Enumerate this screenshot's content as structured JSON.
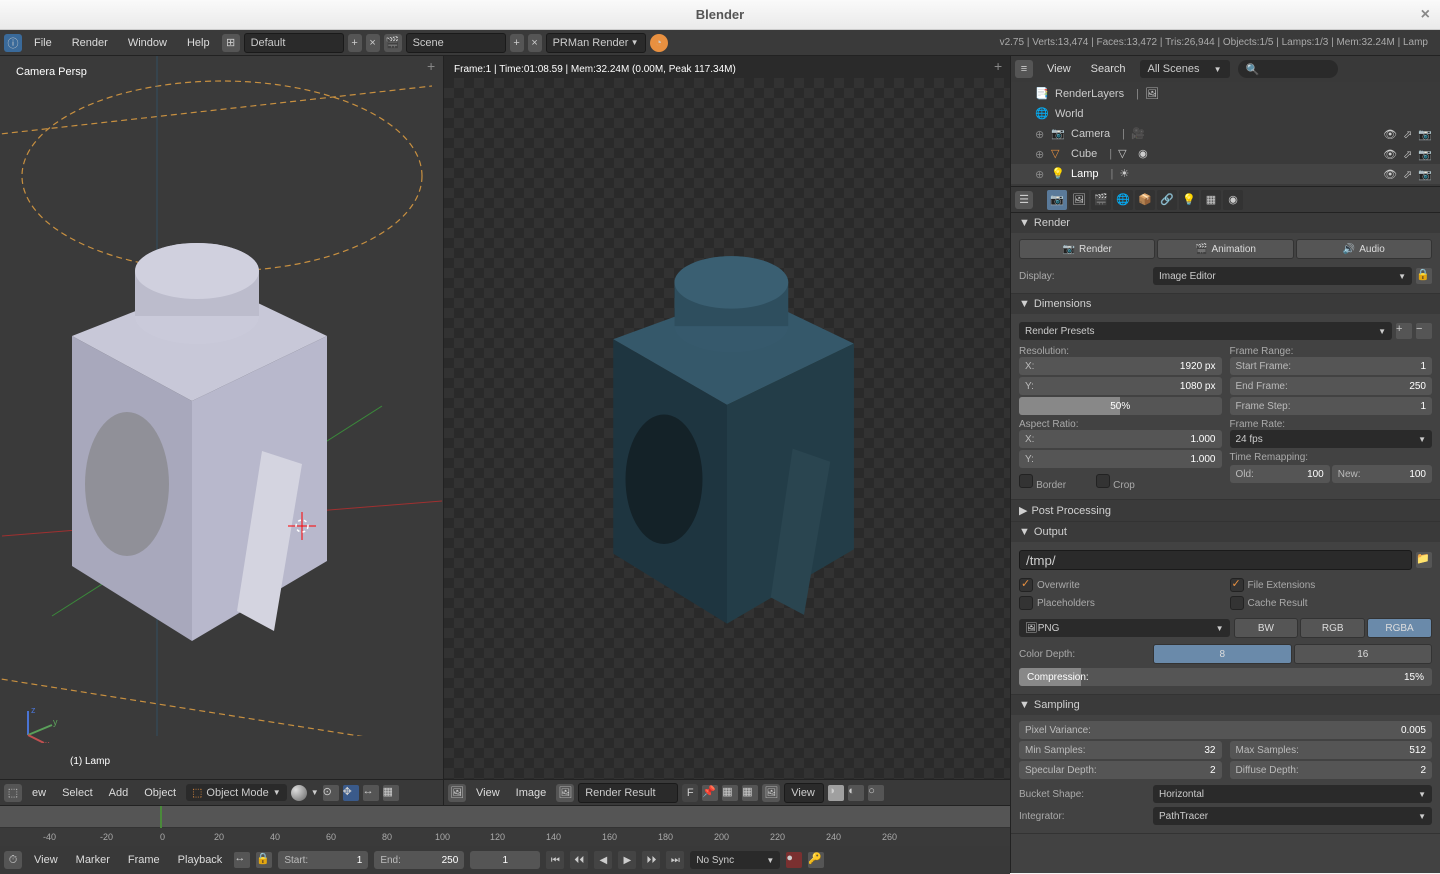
{
  "window": {
    "title": "Blender"
  },
  "header": {
    "menus": {
      "file": "File",
      "render": "Render",
      "window": "Window",
      "help": "Help"
    },
    "layout": "Default",
    "scene": "Scene",
    "render_engine": "PRMan Render",
    "stats": "v2.75 | Verts:13,474 | Faces:13,472 | Tris:26,944 | Objects:1/5 | Lamps:1/3 | Mem:32.24M | Lamp"
  },
  "viewport3d": {
    "label": "Camera Persp",
    "footer_label": "(1) Lamp",
    "header": {
      "view": "ew",
      "select": "Select",
      "add": "Add",
      "object": "Object",
      "mode": "Object Mode"
    }
  },
  "render_view": {
    "info": "Frame:1 | Time:01:08.59 | Mem:32.24M (0.00M, Peak 117.34M)",
    "header": {
      "view": "View",
      "image": "Image",
      "result": "Render Result",
      "f": "F",
      "viewbtn": "View"
    }
  },
  "outliner": {
    "header": {
      "view": "View",
      "search": "Search",
      "scenes": "All Scenes"
    },
    "items": {
      "renderlayers": "RenderLayers",
      "world": "World",
      "camera": "Camera",
      "cube": "Cube",
      "lamp": "Lamp"
    }
  },
  "props": {
    "render_panel": "Render",
    "render_btn": "Render",
    "animation_btn": "Animation",
    "audio_btn": "Audio",
    "display_label": "Display:",
    "display_value": "Image Editor",
    "dimensions_panel": "Dimensions",
    "render_presets": "Render Presets",
    "resolution_label": "Resolution:",
    "res_x_label": "X:",
    "res_x": "1920 px",
    "res_y_label": "Y:",
    "res_y": "1080 px",
    "res_pct": "50%",
    "aspect_label": "Aspect Ratio:",
    "aspect_x_label": "X:",
    "aspect_x": "1.000",
    "aspect_y_label": "Y:",
    "aspect_y": "1.000",
    "border": "Border",
    "crop": "Crop",
    "frame_range": "Frame Range:",
    "start_frame_label": "Start Frame:",
    "start_frame": "1",
    "end_frame_label": "End Frame:",
    "end_frame": "250",
    "frame_step_label": "Frame Step:",
    "frame_step": "1",
    "frame_rate_label": "Frame Rate:",
    "frame_rate": "24 fps",
    "time_remap": "Time Remapping:",
    "old_label": "Old:",
    "old_val": "100",
    "new_label": "New:",
    "new_val": "100",
    "postproc": "Post Processing",
    "output_panel": "Output",
    "output_path": "/tmp/",
    "overwrite": "Overwrite",
    "placeholders": "Placeholders",
    "file_ext": "File Extensions",
    "cache_result": "Cache Result",
    "format": "PNG",
    "bw": "BW",
    "rgb": "RGB",
    "rgba": "RGBA",
    "color_depth": "Color Depth:",
    "cd8": "8",
    "cd16": "16",
    "compression_label": "Compression:",
    "compression": "15%",
    "sampling_panel": "Sampling",
    "pixel_variance_label": "Pixel Variance:",
    "pixel_variance": "0.005",
    "min_samples_label": "Min Samples:",
    "min_samples": "32",
    "max_samples_label": "Max Samples:",
    "max_samples": "512",
    "spec_depth_label": "Specular Depth:",
    "spec_depth": "2",
    "diff_depth_label": "Diffuse Depth:",
    "diff_depth": "2",
    "bucket_shape_label": "Bucket Shape:",
    "bucket_shape": "Horizontal",
    "integrator_label": "Integrator:",
    "integrator": "PathTracer"
  },
  "timeline": {
    "view": "View",
    "marker": "Marker",
    "frame": "Frame",
    "playback": "Playback",
    "start_label": "Start:",
    "start": "1",
    "end_label": "End:",
    "end": "250",
    "current": "1",
    "sync": "No Sync",
    "ticks": [
      "-40",
      "-20",
      "0",
      "20",
      "40",
      "60",
      "80",
      "100",
      "120",
      "140",
      "160",
      "180",
      "200",
      "220",
      "240",
      "260"
    ]
  }
}
